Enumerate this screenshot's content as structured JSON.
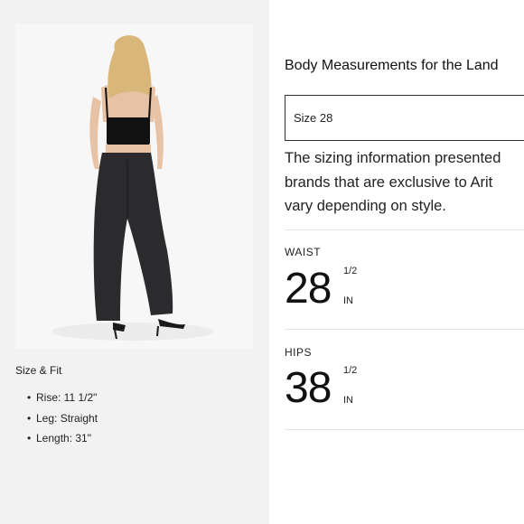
{
  "size_fit": {
    "title": "Size & Fit",
    "items": [
      "Rise: 11 1/2\"",
      "Leg: Straight",
      "Length: 31\""
    ]
  },
  "measurements": {
    "title": "Body Measurements for the Land",
    "size_selected": "Size 28",
    "description_lines": [
      "The sizing information presented",
      "brands that are exclusive to Arit",
      "vary depending on style."
    ],
    "waist": {
      "label": "WAIST",
      "value": "28",
      "fraction": "1/2",
      "unit": "IN"
    },
    "hips": {
      "label": "HIPS",
      "value": "38",
      "fraction": "1/2",
      "unit": "IN"
    }
  }
}
